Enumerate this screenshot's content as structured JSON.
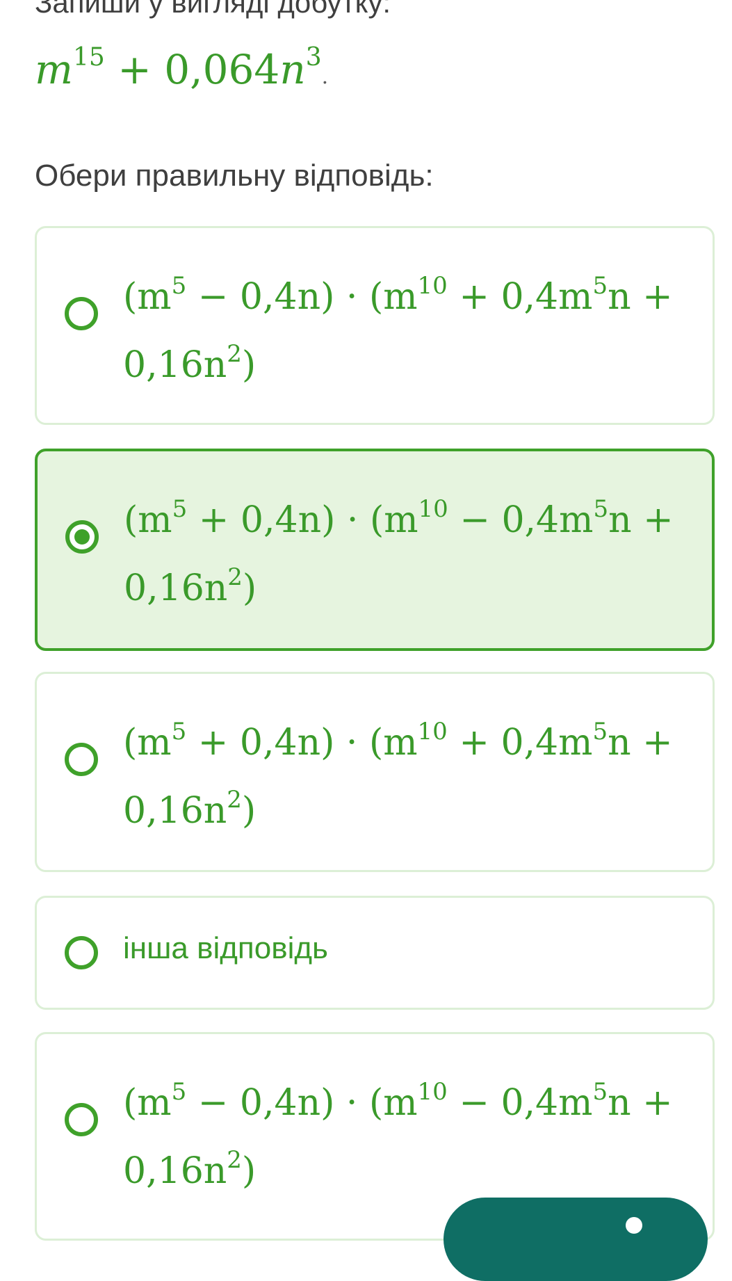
{
  "task": {
    "prompt": "Запиши у вигляді добутку:",
    "expression": {
      "base1": "m",
      "exp1": "15",
      "middle": " + 0,064",
      "base2": "n",
      "exp2": "3",
      "period": "."
    },
    "instruction": "Обери правильну відповідь:"
  },
  "options": [
    {
      "selected": false,
      "l1": {
        "a": "(m",
        "b": "5",
        "c": " − 0,4n) · (m",
        "d": "10",
        "e": " + 0,4m",
        "f": "5",
        "g": "n +"
      },
      "l2": {
        "a": "0,16n",
        "b": "2",
        "c": ")"
      }
    },
    {
      "selected": true,
      "l1": {
        "a": "(m",
        "b": "5",
        "c": " + 0,4n) · (m",
        "d": "10",
        "e": " − 0,4m",
        "f": "5",
        "g": "n +"
      },
      "l2": {
        "a": "0,16n",
        "b": "2",
        "c": ")"
      }
    },
    {
      "selected": false,
      "l1": {
        "a": "(m",
        "b": "5",
        "c": " + 0,4n) · (m",
        "d": "10",
        "e": " + 0,4m",
        "f": "5",
        "g": "n +"
      },
      "l2": {
        "a": "0,16n",
        "b": "2",
        "c": ")"
      }
    },
    {
      "selected": false,
      "label": "інша відповідь"
    },
    {
      "selected": false,
      "l1": {
        "a": "(m",
        "b": "5",
        "c": " − 0,4n) · (m",
        "d": "10",
        "e": " − 0,4m",
        "f": "5",
        "g": "n +"
      },
      "l2": {
        "a": "0,16n",
        "b": "2",
        "c": ")"
      }
    }
  ],
  "colors": {
    "accent": "#3fa12a",
    "math_text": "#3a9a2a",
    "selected_bg": "#e6f4df",
    "card_border": "#dcefd6",
    "next_button": "#0f6e64"
  }
}
